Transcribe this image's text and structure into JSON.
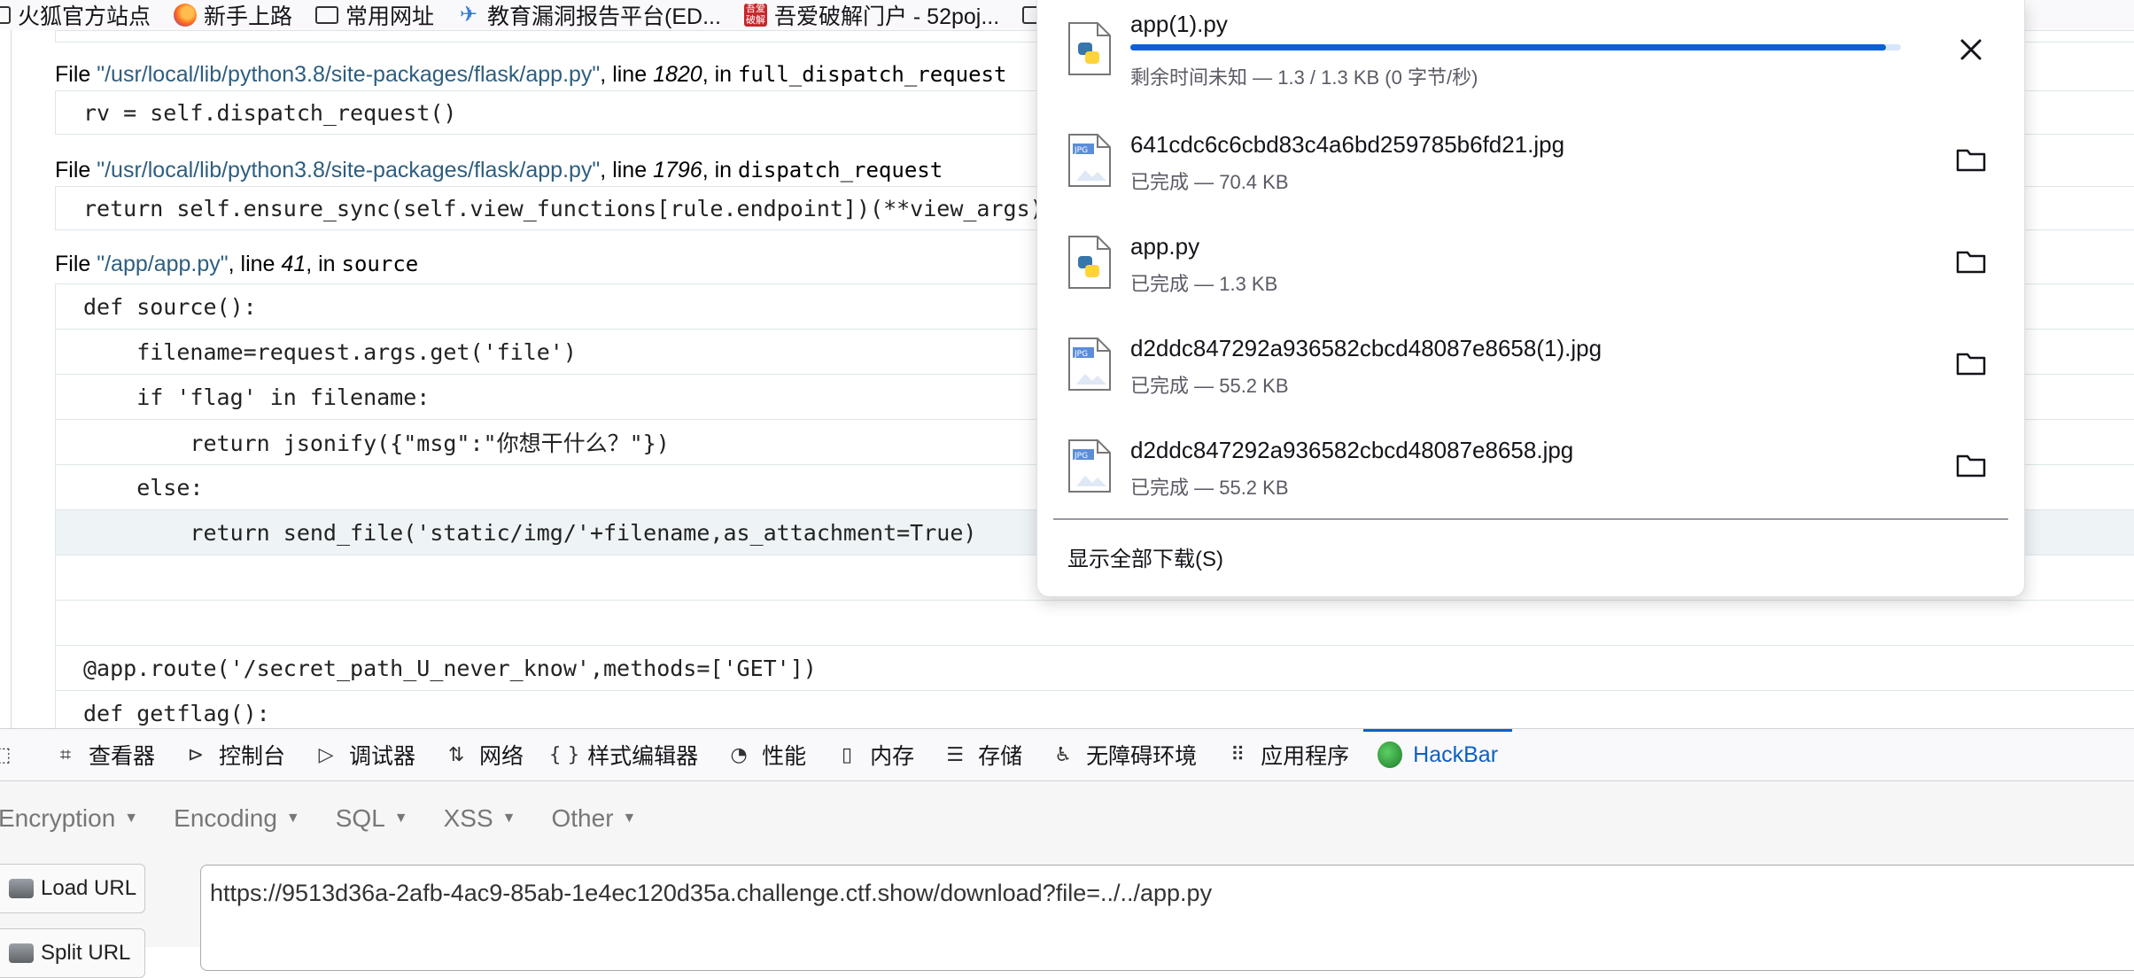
{
  "bookmarks": [
    {
      "label": "火狐官方站点",
      "icon": "folder-icon"
    },
    {
      "label": "新手上路",
      "icon": "firefox-icon"
    },
    {
      "label": "常用网址",
      "icon": "folder-icon"
    },
    {
      "label": "教育漏洞报告平台(ED...",
      "icon": "bird-icon"
    },
    {
      "label": "吾爱破解门户 - 52poj...",
      "icon": "52pojie-icon"
    }
  ],
  "traceback": {
    "frames": [
      {
        "file_prefix": "File ",
        "path": "\"/usr/local/lib/python3.8/site-packages/flask/app.py\"",
        "line_word": ", line ",
        "line_no": "1820",
        "in_word": ", in ",
        "func": "full_dispatch_request",
        "code": "rv = self.dispatch_request()"
      },
      {
        "file_prefix": "File ",
        "path": "\"/usr/local/lib/python3.8/site-packages/flask/app.py\"",
        "line_word": ", line ",
        "line_no": "1796",
        "in_word": ", in ",
        "func": "dispatch_request",
        "code": "return self.ensure_sync(self.view_functions[rule.endpoint])(**view_args)"
      },
      {
        "file_prefix": "File ",
        "path": "\"/app/app.py\"",
        "line_word": ", line ",
        "line_no": "41",
        "in_word": ", in ",
        "func": "source"
      }
    ],
    "source_lines": [
      "def source():",
      "    filename=request.args.get('file')",
      "    if 'flag' in filename:",
      "        return jsonify({\"msg\":\"你想干什么？\"})",
      "    else:",
      "        return send_file('static/img/'+filename,as_attachment=True)",
      "",
      "",
      "@app.route('/secret_path_U_never_know',methods=['GET'])",
      "def getflag():"
    ]
  },
  "downloads": {
    "items": [
      {
        "name": "app(1).py",
        "status": "剩余时间未知 — 1.3 / 1.3 KB (0 字节/秒)",
        "icon": "python-file-icon",
        "in_progress": true,
        "progress": 0.98,
        "action": "cancel-icon"
      },
      {
        "name": "641cdc6c6cbd83c4a6bd259785b6fd21.jpg",
        "status": "已完成 — 70.4 KB",
        "icon": "jpg-file-icon",
        "in_progress": false,
        "action": "folder-icon"
      },
      {
        "name": "app.py",
        "status": "已完成 — 1.3 KB",
        "icon": "python-file-icon",
        "in_progress": false,
        "action": "folder-icon"
      },
      {
        "name": "d2ddc847292a936582cbcd48087e8658(1).jpg",
        "status": "已完成 — 55.2 KB",
        "icon": "jpg-file-icon",
        "in_progress": false,
        "action": "folder-icon"
      },
      {
        "name": "d2ddc847292a936582cbcd48087e8658.jpg",
        "status": "已完成 — 55.2 KB",
        "icon": "jpg-file-icon",
        "in_progress": false,
        "action": "folder-icon"
      }
    ],
    "show_all": "显示全部下载(S)"
  },
  "devtools": {
    "tabs": [
      {
        "label": "查看器",
        "icon": "inspector-icon"
      },
      {
        "label": "控制台",
        "icon": "console-icon"
      },
      {
        "label": "调试器",
        "icon": "debugger-icon"
      },
      {
        "label": "网络",
        "icon": "network-icon"
      },
      {
        "label": "样式编辑器",
        "icon": "style-editor-icon"
      },
      {
        "label": "性能",
        "icon": "performance-icon"
      },
      {
        "label": "内存",
        "icon": "memory-icon"
      },
      {
        "label": "存储",
        "icon": "storage-icon"
      },
      {
        "label": "无障碍环境",
        "icon": "accessibility-icon"
      },
      {
        "label": "应用程序",
        "icon": "application-icon"
      },
      {
        "label": "HackBar",
        "icon": "hackbar-icon",
        "active": true
      }
    ]
  },
  "hackbar": {
    "menu": [
      "Encryption",
      "Encoding",
      "SQL",
      "XSS",
      "Other"
    ],
    "load_url": "Load URL",
    "split_url": "Split URL",
    "url": "https://9513d36a-2afb-4ac9-85ab-1e4ec120d35a.challenge.ctf.show/download?file=../../app.py"
  },
  "colors": {
    "accent": "#0b61c4",
    "progress": "#0b5fd8",
    "path": "#2e5e7e"
  }
}
